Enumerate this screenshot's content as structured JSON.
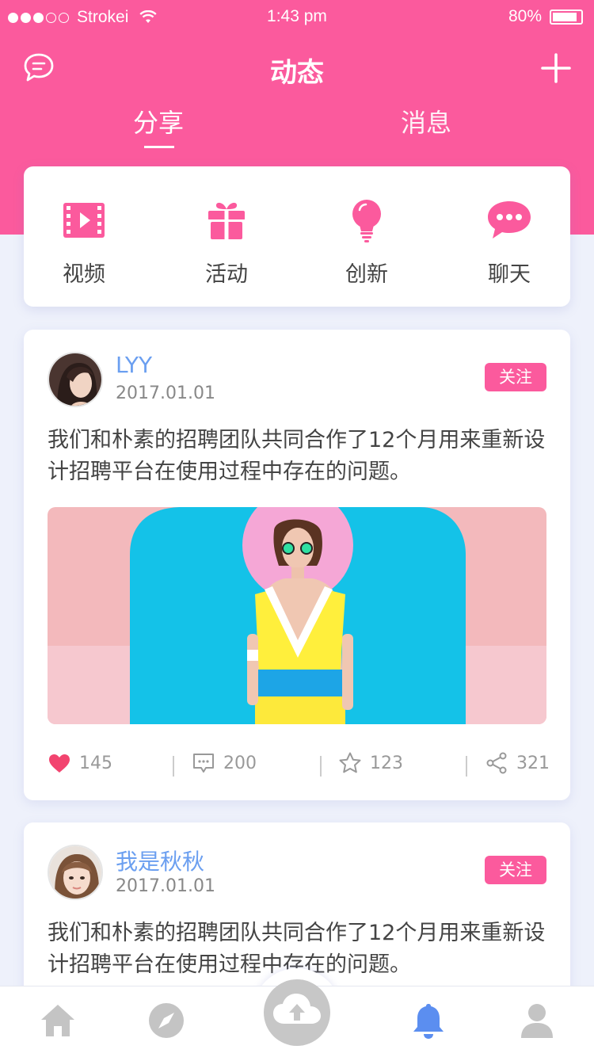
{
  "status_bar": {
    "carrier": "Strokei",
    "time": "1:43 pm",
    "battery": "80%"
  },
  "nav": {
    "title": "动态",
    "left_icon": "chat-bubble-icon",
    "right_icon": "plus-icon"
  },
  "tabs": [
    {
      "label": "分享",
      "active": true
    },
    {
      "label": "消息",
      "active": false
    }
  ],
  "categories": [
    {
      "label": "视频",
      "icon": "video-icon"
    },
    {
      "label": "活动",
      "icon": "gift-icon"
    },
    {
      "label": "创新",
      "icon": "lightbulb-icon"
    },
    {
      "label": "聊天",
      "icon": "chat-dots-icon"
    }
  ],
  "posts": [
    {
      "username": "LYY",
      "date": "2017.01.01",
      "follow_label": "关注",
      "text": "我们和朴素的招聘团队共同合作了12个月用来重新设计招聘平台在使用过程中存在的问题。",
      "stats": {
        "likes": "145",
        "comments": "200",
        "stars": "123",
        "shares": "321"
      }
    },
    {
      "username": "我是秋秋",
      "date": "2017.01.01",
      "follow_label": "关注",
      "text": "我们和朴素的招聘团队共同合作了12个月用来重新设计招聘平台在使用过程中存在的问题。"
    }
  ],
  "tabbar": [
    {
      "icon": "home-icon"
    },
    {
      "icon": "compass-icon"
    },
    {
      "icon": "cloud-upload-icon"
    },
    {
      "icon": "bell-icon",
      "active": true
    },
    {
      "icon": "user-icon"
    }
  ],
  "colors": {
    "brand_pink": "#fb5a9d",
    "username_blue": "#6b9ff0",
    "active_tab_blue": "#5b8ef0",
    "background": "#eef1fb"
  }
}
